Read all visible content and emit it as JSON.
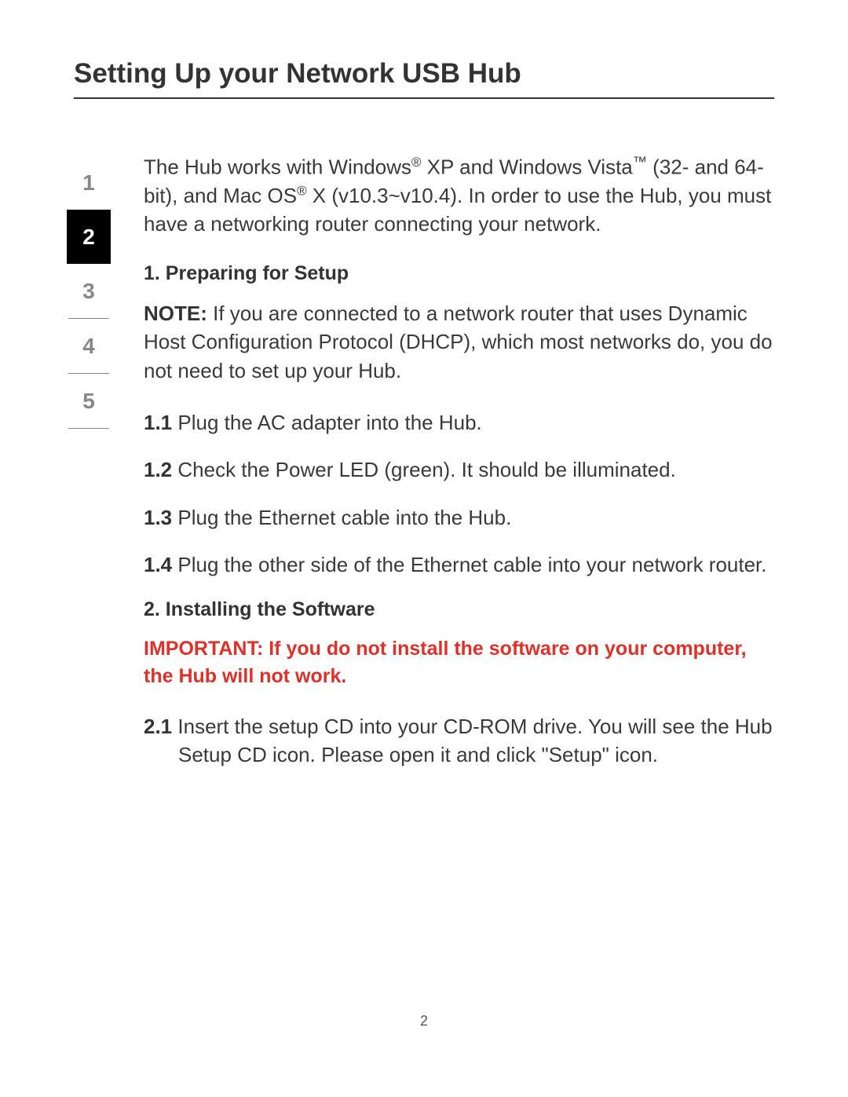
{
  "title": "Setting Up your Network USB Hub",
  "nav": {
    "items": [
      "1",
      "2",
      "3",
      "4",
      "5"
    ],
    "activeIndex": 1
  },
  "intro": {
    "text_part1": "The Hub works with Windows",
    "text_part2": " XP and Windows Vista",
    "text_part3": " (32- and 64-bit), and Mac OS",
    "text_part4": " X (v10.3~v10.4). In order to use the Hub, you must have a networking router connecting your network."
  },
  "section1": {
    "heading": "1. Preparing for Setup",
    "note_label": "NOTE:",
    "note_text": " If you are connected to a network router that uses Dynamic Host Configuration Protocol (DHCP), which most networks do, you do not need to set up your Hub.",
    "steps": [
      {
        "num": "1.1",
        "text": " Plug the AC adapter into the Hub."
      },
      {
        "num": "1.2",
        "text": " Check the Power LED (green). It should be illuminated."
      },
      {
        "num": "1.3",
        "text": " Plug the Ethernet cable into the Hub."
      },
      {
        "num": "1.4",
        "text": " Plug the other side of the Ethernet cable into your network router."
      }
    ]
  },
  "section2": {
    "heading": "2. Installing the Software",
    "important": "IMPORTANT: If you do not install the software on your computer, the Hub will not work.",
    "steps": [
      {
        "num": "2.1",
        "text": " Insert the setup CD into your CD-ROM drive. You will see the Hub Setup CD icon. Please open it and click \"Setup\" icon."
      }
    ]
  },
  "pageNumber": "2"
}
